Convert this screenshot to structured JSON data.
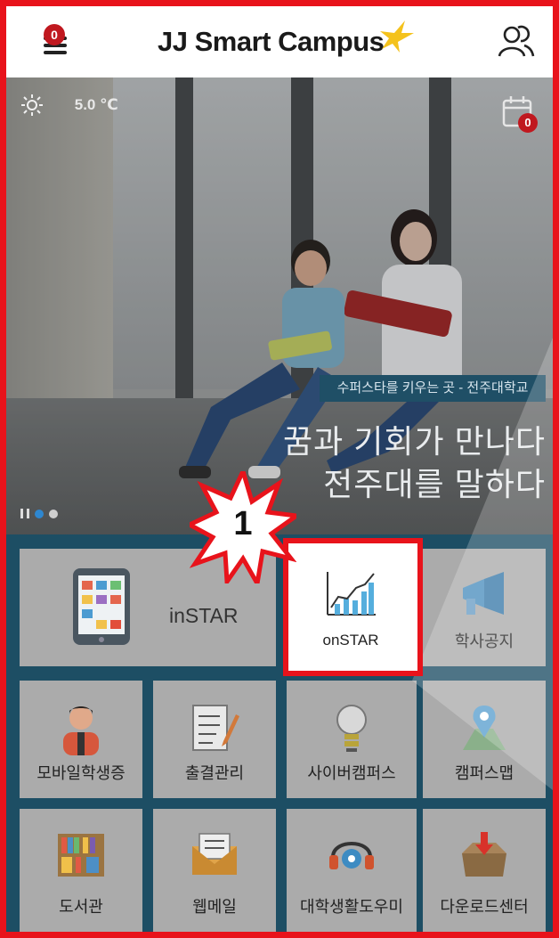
{
  "header": {
    "menu_badge": "0",
    "brand": "JJ Smart Campus"
  },
  "banner": {
    "weather_temp": "5.0 ℃",
    "calendar_badge": "0",
    "tagline": "수퍼스타를 키우는 곳 - 전주대학교",
    "slogan_line1": "꿈과 기회가 만나다",
    "slogan_line2": "전주대를 말하다",
    "slide_count": 2,
    "active_slide": 1
  },
  "menu": {
    "instar": "inSTAR",
    "onstar": "onSTAR",
    "notice": "학사공지",
    "student_id": "모바일학생증",
    "attendance": "출결관리",
    "cyber_campus": "사이버캠퍼스",
    "campus_map": "캠퍼스맵",
    "library": "도서관",
    "webmail": "웹메일",
    "helper": "대학생활도우미",
    "download": "다운로드센터"
  },
  "annotation": {
    "step_number": "1"
  },
  "colors": {
    "highlight": "#e8131b",
    "grid_bg": "#1d4e64",
    "badge": "#c0181f",
    "active_dot": "#2e87d0"
  }
}
